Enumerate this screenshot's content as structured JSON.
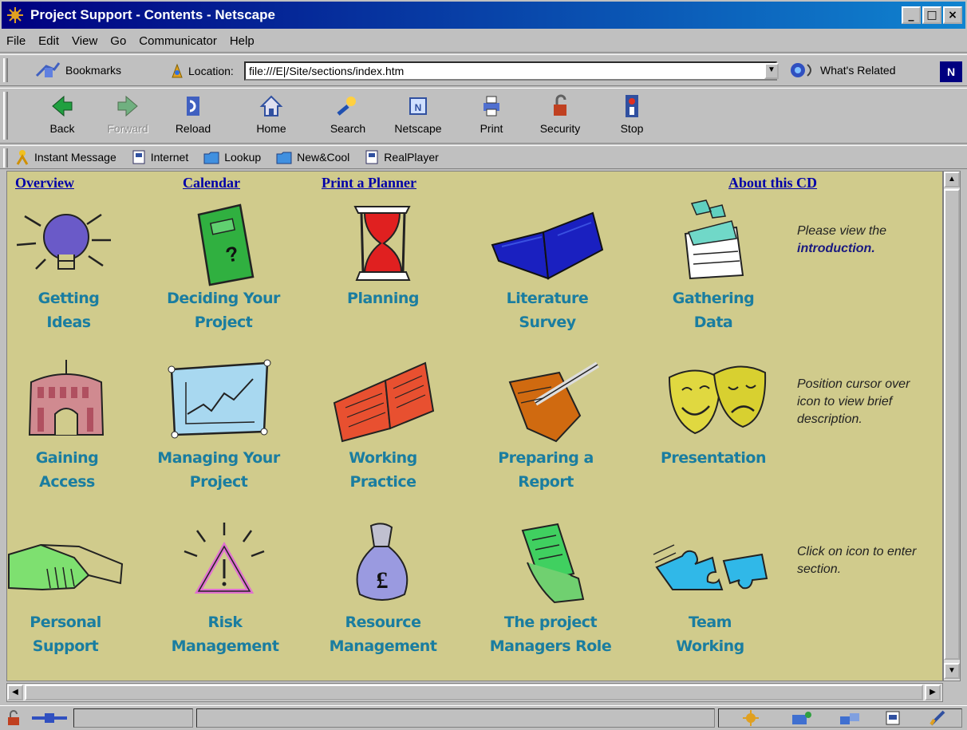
{
  "window": {
    "title": "Project Support - Contents - Netscape",
    "controls": [
      "_",
      "□",
      "×"
    ]
  },
  "menu": [
    "File",
    "Edit",
    "View",
    "Go",
    "Communicator",
    "Help"
  ],
  "location_bar": {
    "bookmarks_label": "Bookmarks",
    "location_label": "Location:",
    "url": "file:///E|/Site/sections/index.htm",
    "related_label": "What's Related",
    "logo": "N"
  },
  "toolbar": {
    "back": "Back",
    "forward": "Forward",
    "reload": "Reload",
    "home": "Home",
    "search": "Search",
    "netscape": "Netscape",
    "print": "Print",
    "security": "Security",
    "stop": "Stop"
  },
  "personal_bar": [
    "Instant Message",
    "Internet",
    "Lookup",
    "New&Cool",
    "RealPlayer"
  ],
  "top_links": {
    "overview": "Overview",
    "calendar": "Calendar",
    "planner": "Print a Planner",
    "about": "About this CD"
  },
  "sections": {
    "getting_ideas": [
      "Getting",
      "Ideas"
    ],
    "deciding": [
      "Deciding Your",
      "Project"
    ],
    "planning": [
      "Planning",
      ""
    ],
    "literature": [
      "Literature",
      "Survey"
    ],
    "gathering": [
      "Gathering",
      "Data"
    ],
    "gaining": [
      "Gaining",
      "Access"
    ],
    "managing": [
      "Managing Your",
      "Project"
    ],
    "working": [
      "Working",
      "Practice"
    ],
    "preparing": [
      "Preparing a",
      "Report"
    ],
    "presentation": [
      "Presentation",
      ""
    ],
    "personal": [
      "Personal",
      "Support"
    ],
    "risk": [
      "Risk",
      "Management"
    ],
    "resource": [
      "Resource",
      "Management"
    ],
    "pm_role": [
      "The project",
      "Managers Role"
    ],
    "team": [
      "Team",
      "Working"
    ]
  },
  "notes": {
    "intro_1": "Please view the",
    "intro_link": "introduction.",
    "cursor": "Position cursor over icon to view brief description.",
    "click": "Click on icon to enter section."
  },
  "colors": {
    "page_bg": "#d0cb8c",
    "section_label": "#1a7da0",
    "link": "#0000a8",
    "title_bar": "#000080"
  }
}
